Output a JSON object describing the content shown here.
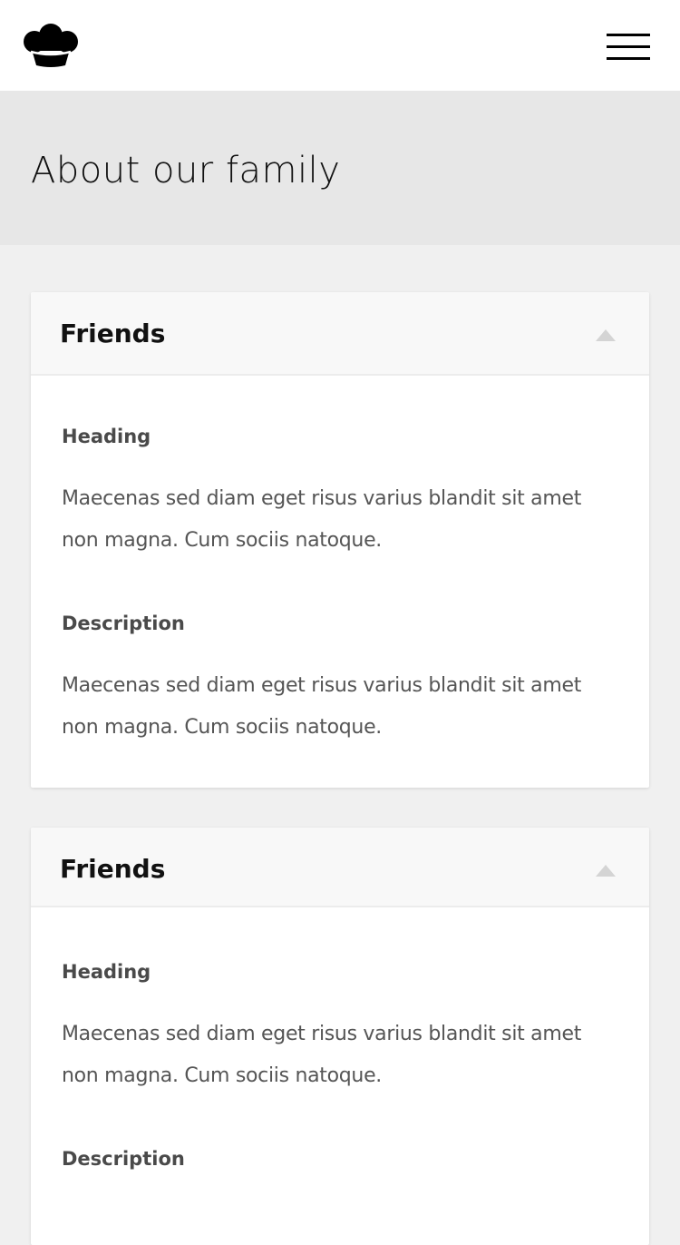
{
  "header": {
    "logo_icon": "chef-hat-icon",
    "menu_icon": "hamburger-menu-icon"
  },
  "hero": {
    "title": "About our family"
  },
  "cards": [
    {
      "title": "Friends",
      "toggle_icon": "triangle-up-icon",
      "sections": [
        {
          "label": "Heading",
          "text": "Maecenas sed diam eget risus varius blandit sit amet non magna. Cum sociis natoque."
        },
        {
          "label": "Description",
          "text": "Maecenas sed diam eget risus varius blandit sit amet non magna. Cum sociis natoque."
        }
      ]
    },
    {
      "title": "Friends",
      "toggle_icon": "triangle-up-icon",
      "sections": [
        {
          "label": "Heading",
          "text": "Maecenas sed diam eget risus varius blandit sit amet non magna. Cum sociis natoque."
        },
        {
          "label": "Description",
          "text": ""
        }
      ]
    }
  ],
  "colors": {
    "page_background": "#f0f0f0",
    "hero_background": "#e7e7e7",
    "card_header_background": "#f8f8f8",
    "text_dark": "#111111",
    "text_body": "#555555"
  }
}
